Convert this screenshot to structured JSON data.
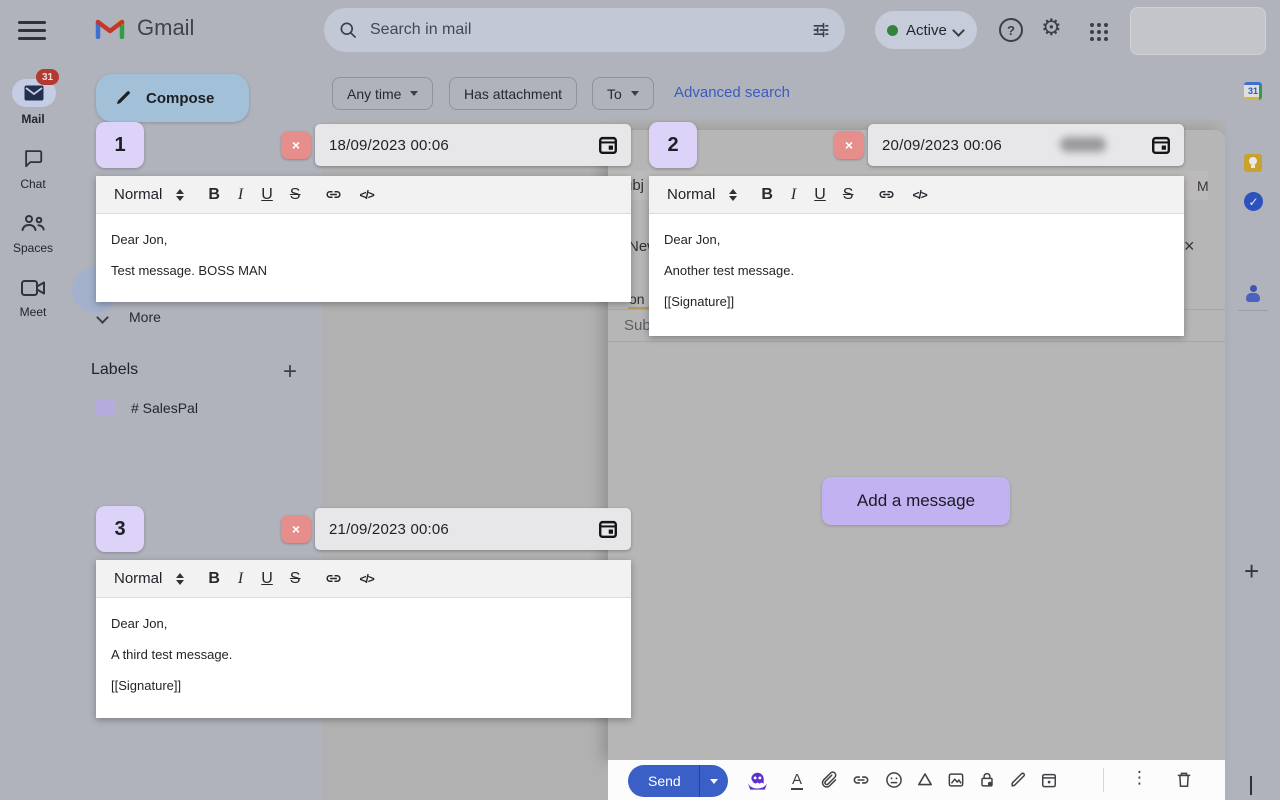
{
  "topbar": {
    "logo_text": "Gmail",
    "search_placeholder": "Search in mail",
    "status_label": "Active",
    "help_glyph": "?"
  },
  "filters": {
    "any_time": "Any time",
    "has_attachment": "Has attachment",
    "to": "To",
    "advanced_search": "Advanced search"
  },
  "nav_rail": {
    "items": [
      {
        "label": "Mail",
        "badge": "31"
      },
      {
        "label": "Chat"
      },
      {
        "label": "Spaces"
      },
      {
        "label": "Meet"
      }
    ]
  },
  "sidebar": {
    "compose_label": "Compose",
    "more_label": "More",
    "labels_heading": "Labels",
    "add_label_glyph": "+",
    "label_item": "# SalesPal"
  },
  "editor_toolbar": {
    "paragraph_style": "Normal",
    "bold": "B",
    "italic": "I",
    "underline": "U",
    "strikethrough": "S",
    "code": "</>"
  },
  "followups": {
    "close_glyph": "×",
    "add_message_label": "Add a message",
    "panels": [
      {
        "number": "1",
        "datetime": "18/09/2023 00:06",
        "lines": [
          "Dear Jon,",
          "Test message. BOSS MAN"
        ]
      },
      {
        "number": "2",
        "datetime": "20/09/2023 00:06",
        "lines": [
          "Dear Jon,",
          "Another test message.",
          "[[Signature]]"
        ]
      },
      {
        "number": "3",
        "datetime": "21/09/2023 00:06",
        "lines": [
          "Dear Jon,",
          "A third test message.",
          "[[Signature]]"
        ]
      }
    ]
  },
  "compose_background": {
    "subject_top_fragment": "ubj",
    "time_fragment": "M",
    "header_fragment": "New",
    "close_glyph": "×",
    "recipient_fragment": "on",
    "subject_fragment": "Sub"
  },
  "send_toolbar": {
    "send_label": "Send",
    "format_letter": "A",
    "more_options_glyph": "⋮"
  },
  "side_panel": {
    "calendar_day": "31",
    "add_glyph": "+"
  },
  "colors": {
    "badge_purple": "#ddd3f8",
    "button_purple": "#c2b2f2",
    "close_red": "#e58e8c",
    "send_blue": "#3a60c8",
    "link_blue": "#3b5bbf",
    "active_green": "#35823c",
    "ghost_purple": "#5b2fd0"
  }
}
